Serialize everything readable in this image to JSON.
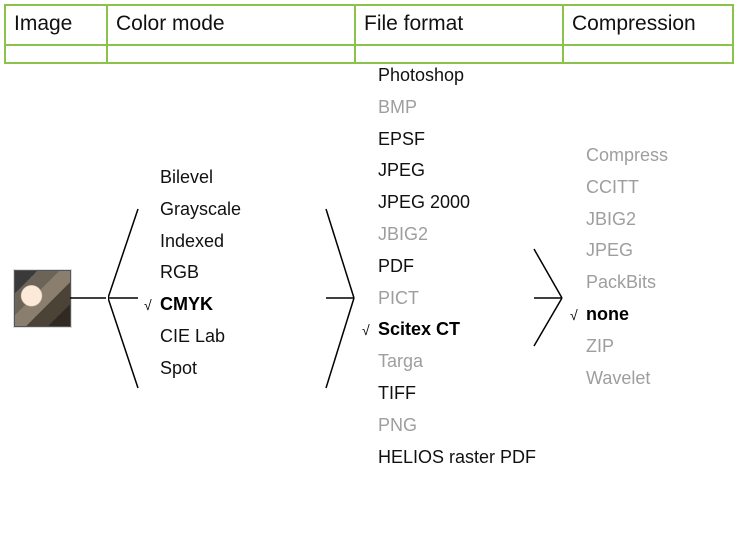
{
  "headers": {
    "image": "Image",
    "mode": "Color mode",
    "format": "File format",
    "compression": "Compression"
  },
  "check_mark": "√",
  "color_modes": [
    {
      "label": "Bilevel",
      "dim": false,
      "selected": false
    },
    {
      "label": "Grayscale",
      "dim": false,
      "selected": false
    },
    {
      "label": "Indexed",
      "dim": false,
      "selected": false
    },
    {
      "label": "RGB",
      "dim": false,
      "selected": false
    },
    {
      "label": "CMYK",
      "dim": false,
      "selected": true
    },
    {
      "label": "CIE Lab",
      "dim": false,
      "selected": false
    },
    {
      "label": "Spot",
      "dim": false,
      "selected": false
    }
  ],
  "file_formats": [
    {
      "label": "Photoshop",
      "dim": false,
      "selected": false
    },
    {
      "label": "BMP",
      "dim": true,
      "selected": false
    },
    {
      "label": "EPSF",
      "dim": false,
      "selected": false
    },
    {
      "label": "JPEG",
      "dim": false,
      "selected": false
    },
    {
      "label": "JPEG 2000",
      "dim": false,
      "selected": false
    },
    {
      "label": "JBIG2",
      "dim": true,
      "selected": false
    },
    {
      "label": "PDF",
      "dim": false,
      "selected": false
    },
    {
      "label": "PICT",
      "dim": true,
      "selected": false
    },
    {
      "label": "Scitex CT",
      "dim": false,
      "selected": true
    },
    {
      "label": "Targa",
      "dim": true,
      "selected": false
    },
    {
      "label": "TIFF",
      "dim": false,
      "selected": false
    },
    {
      "label": "PNG",
      "dim": true,
      "selected": false
    },
    {
      "label": "HELIOS raster PDF",
      "dim": false,
      "selected": false
    }
  ],
  "compressions": [
    {
      "label": "Compress",
      "dim": true,
      "selected": false
    },
    {
      "label": "CCITT",
      "dim": true,
      "selected": false
    },
    {
      "label": "JBIG2",
      "dim": true,
      "selected": false
    },
    {
      "label": "JPEG",
      "dim": true,
      "selected": false
    },
    {
      "label": "PackBits",
      "dim": true,
      "selected": false
    },
    {
      "label": "none",
      "dim": false,
      "selected": true
    },
    {
      "label": "ZIP",
      "dim": true,
      "selected": false
    },
    {
      "label": "Wavelet",
      "dim": true,
      "selected": false
    }
  ]
}
